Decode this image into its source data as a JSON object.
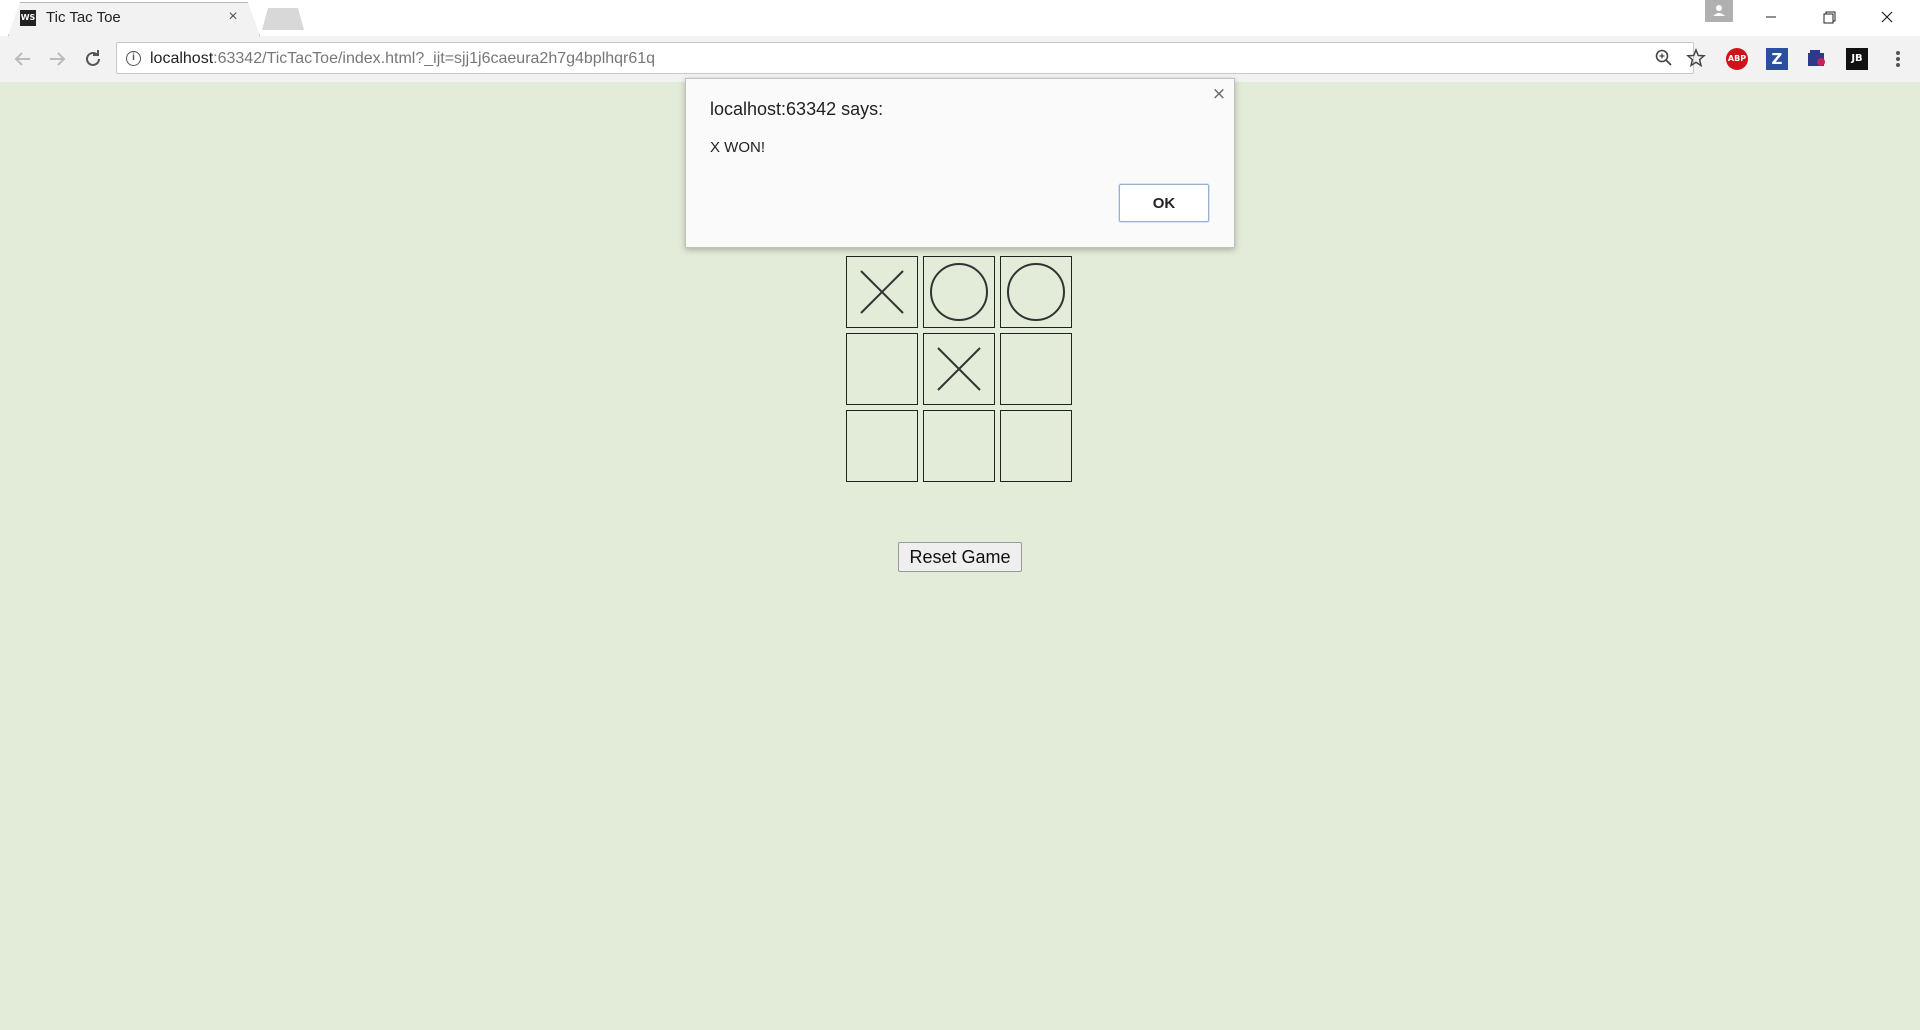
{
  "browser": {
    "tab_title": "Tic Tac Toe",
    "tab_favicon_text": "WS",
    "tab_close": "×",
    "url_host": "localhost",
    "url_rest": ":63342/TicTacToe/index.html?_ijt=sjj1j6caeura2h7g4bplhqr61q",
    "extensions": [
      {
        "name": "adblock-plus",
        "text": "ABP",
        "color": "#d0131a"
      },
      {
        "name": "zotero",
        "text": "Z",
        "color": "#2a4ea0"
      },
      {
        "name": "extension-3",
        "text": "",
        "color": "#2d3a8c"
      },
      {
        "name": "jetbrains",
        "text": "JB",
        "color": "#111111"
      }
    ]
  },
  "dialog": {
    "title": "localhost:63342 says:",
    "message": "X WON!",
    "ok_label": "OK",
    "close_symbol": "×"
  },
  "game": {
    "board": [
      [
        "X",
        "O",
        "O"
      ],
      [
        "",
        "X",
        ""
      ],
      [
        "",
        "",
        ""
      ]
    ],
    "reset_label": "Reset Game"
  },
  "colors": {
    "page_background": "#e2ecd8",
    "mark_stroke": "#333333"
  }
}
